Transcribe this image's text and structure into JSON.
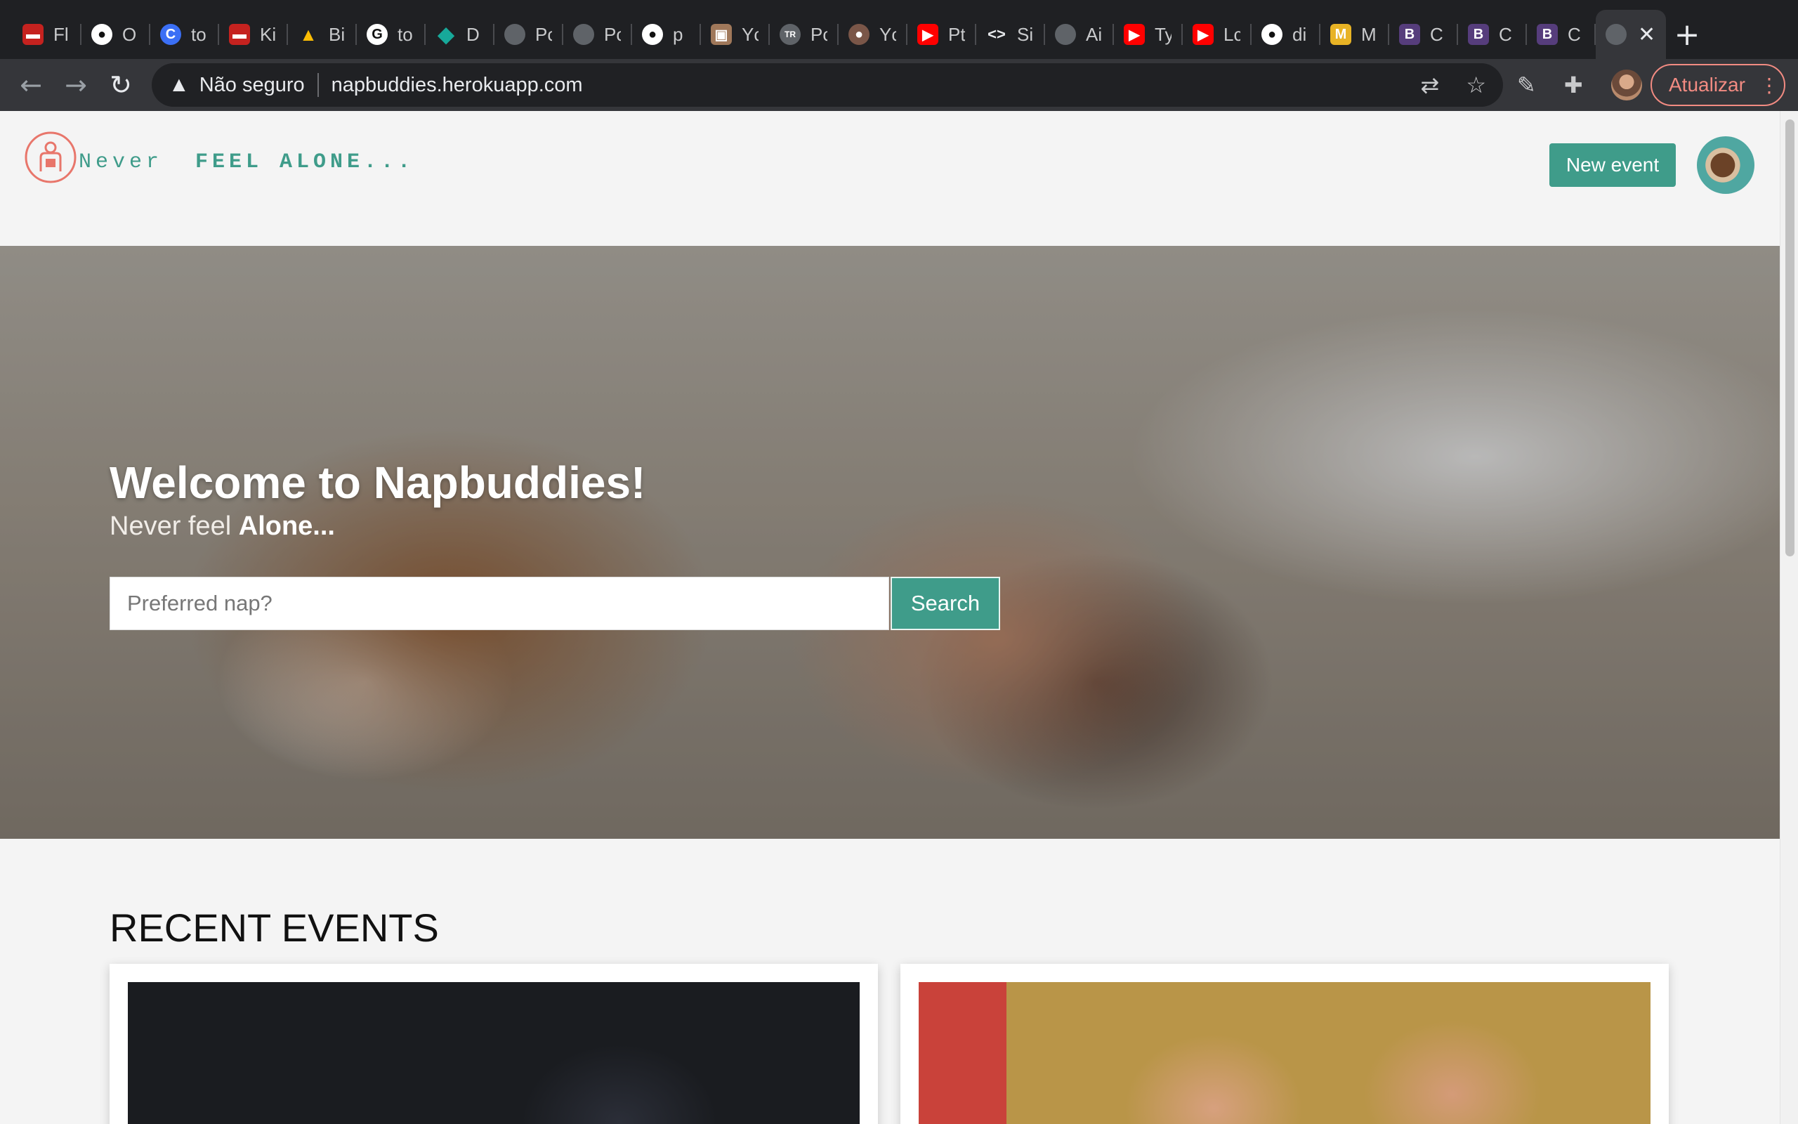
{
  "browser": {
    "tabs": [
      {
        "title": "Fl",
        "icon": "bus-icon",
        "color": "#c5221f"
      },
      {
        "title": "O",
        "icon": "github-icon",
        "color": "#ffffff"
      },
      {
        "title": "to",
        "icon": "c-circle-icon",
        "color": "#3b6ff5"
      },
      {
        "title": "Ki",
        "icon": "bus-icon",
        "color": "#c5221f"
      },
      {
        "title": "Bi",
        "icon": "google-drive-icon",
        "color": "#1fa463"
      },
      {
        "title": "to",
        "icon": "google-icon",
        "color": "#ffffff"
      },
      {
        "title": "D",
        "icon": "diamond-icon",
        "color": "#17a99a"
      },
      {
        "title": "Pc",
        "icon": "globe-icon",
        "color": "#5f6368"
      },
      {
        "title": "Pc",
        "icon": "globe-icon",
        "color": "#5f6368"
      },
      {
        "title": "p",
        "icon": "github-icon",
        "color": "#ffffff"
      },
      {
        "title": "Yc",
        "icon": "photo-icon",
        "color": "#a0785a"
      },
      {
        "title": "Pc",
        "icon": "tr-icon",
        "color": "#5f6368"
      },
      {
        "title": "Yc",
        "icon": "avatar-icon",
        "color": "#7a5648"
      },
      {
        "title": "Pt",
        "icon": "youtube-icon",
        "color": "#ff0000"
      },
      {
        "title": "Si",
        "icon": "code-icon",
        "color": "#ffffff"
      },
      {
        "title": "Ai",
        "icon": "globe-icon",
        "color": "#5f6368"
      },
      {
        "title": "Ty",
        "icon": "youtube-icon",
        "color": "#ff0000"
      },
      {
        "title": "Lc",
        "icon": "youtube-icon",
        "color": "#ff0000"
      },
      {
        "title": "di",
        "icon": "github-icon",
        "color": "#ffffff"
      },
      {
        "title": "M",
        "icon": "m-tile-icon",
        "color": "#e8b325"
      },
      {
        "title": "C",
        "icon": "bootstrap-icon",
        "color": "#563d7c"
      },
      {
        "title": "C",
        "icon": "bootstrap-icon",
        "color": "#563d7c"
      },
      {
        "title": "C",
        "icon": "bootstrap-icon",
        "color": "#563d7c"
      }
    ],
    "active_tab": {
      "title": "",
      "icon": "globe-icon"
    },
    "address": {
      "security_label": "Não seguro",
      "url": "napbuddies.herokuapp.com"
    },
    "update_label": "Atualizar"
  },
  "header": {
    "tagline_word1": "Never",
    "tagline_word2": "FEEL ALONE...",
    "new_event_label": "New event"
  },
  "hero": {
    "title": "Welcome to Napbuddies!",
    "subtitle_prefix": "Never feel ",
    "subtitle_bold": "Alone...",
    "search_placeholder": "Preferred nap?",
    "search_value": "",
    "search_button": "Search"
  },
  "recent": {
    "title": "RECENT EVENTS"
  },
  "colors": {
    "brand": "#3f9c8a",
    "logo": "#e8766b",
    "chrome_bg": "#1f2023",
    "toolbar_bg": "#35363a"
  }
}
